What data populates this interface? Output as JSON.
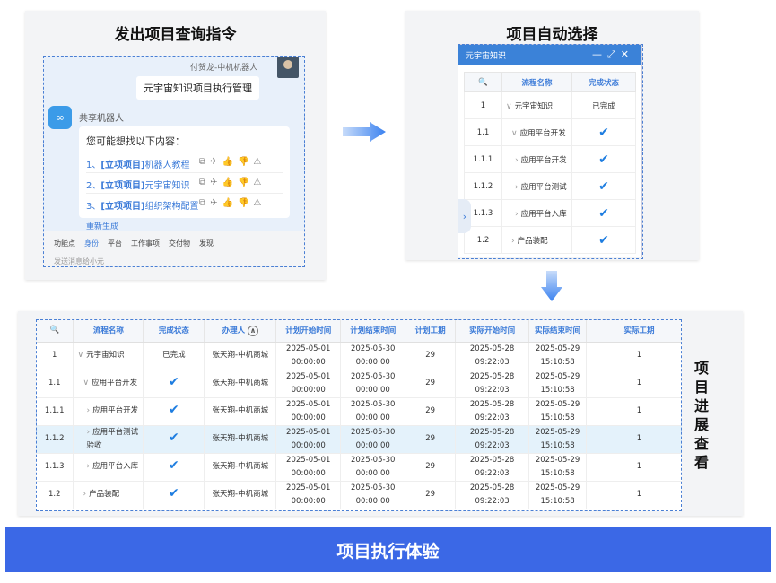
{
  "panel1": {
    "title": "发出项目查询指令",
    "sender": "付贺龙-中机机器人",
    "user_message": "元宇宙知识项目执行管理",
    "bot_name": "共享机器人",
    "bot_intro": "您可能想找以下内容：",
    "suggestions": [
      {
        "num": "1、",
        "tag": "[立项项目]",
        "text": "机器人教程"
      },
      {
        "num": "2、",
        "tag": "[立项项目]",
        "text": "元宇宙知识"
      },
      {
        "num": "3、",
        "tag": "[立项项目]",
        "text": "组织架构配置"
      }
    ],
    "regen": "重新生成",
    "toolbar": [
      "功能点",
      "身份",
      "平台",
      "工作事项",
      "交付物",
      "发现"
    ],
    "input_placeholder": "发送消息给小元"
  },
  "panel2": {
    "title": "项目自动选择",
    "widget_title": "元宇宙知识",
    "headers": [
      "流程名称",
      "完成状态"
    ],
    "rows": [
      {
        "id": "1",
        "name": "元宇宙知识",
        "status": "已完成"
      },
      {
        "id": "1.1",
        "name": "应用平台开发",
        "status": "check"
      },
      {
        "id": "1.1.1",
        "name": "应用平台开发",
        "status": "check"
      },
      {
        "id": "1.1.2",
        "name": "应用平台测试",
        "status": "check"
      },
      {
        "id": "1.1.3",
        "name": "应用平台入库",
        "status": "check"
      },
      {
        "id": "1.2",
        "name": "产品装配",
        "status": "check"
      }
    ]
  },
  "panel3": {
    "side_label": "项目进展查看",
    "headers": [
      "流程名称",
      "完成状态",
      "办理人",
      "计划开始时间",
      "计划结束时间",
      "计划工期",
      "实际开始时间",
      "实际结束时间",
      "实际工期"
    ],
    "rows": [
      {
        "id": "1",
        "name": "元宇宙知识",
        "status": "已完成",
        "owner": "张天翔-中机商城",
        "ps_date": "2025-05-01",
        "ps_time": "00:00:00",
        "pe_date": "2025-05-30",
        "pe_time": "00:00:00",
        "plan_days": "29",
        "as_date": "2025-05-28",
        "as_time": "09:22:03",
        "ae_date": "2025-05-29",
        "ae_time": "15:10:58",
        "actual_days": "1"
      },
      {
        "id": "1.1",
        "name": "应用平台开发",
        "status": "check",
        "owner": "张天翔-中机商城",
        "ps_date": "2025-05-01",
        "ps_time": "00:00:00",
        "pe_date": "2025-05-30",
        "pe_time": "00:00:00",
        "plan_days": "29",
        "as_date": "2025-05-28",
        "as_time": "09:22:03",
        "ae_date": "2025-05-29",
        "ae_time": "15:10:58",
        "actual_days": "1"
      },
      {
        "id": "1.1.1",
        "name": "应用平台开发",
        "status": "check",
        "owner": "张天翔-中机商城",
        "ps_date": "2025-05-01",
        "ps_time": "00:00:00",
        "pe_date": "2025-05-30",
        "pe_time": "00:00:00",
        "plan_days": "29",
        "as_date": "2025-05-28",
        "as_time": "09:22:03",
        "ae_date": "2025-05-29",
        "ae_time": "15:10:58",
        "actual_days": "1"
      },
      {
        "id": "1.1.2",
        "name": "应用平台测试验收",
        "status": "check",
        "owner": "张天翔-中机商城",
        "ps_date": "2025-05-01",
        "ps_time": "00:00:00",
        "pe_date": "2025-05-30",
        "pe_time": "00:00:00",
        "plan_days": "29",
        "as_date": "2025-05-28",
        "as_time": "09:22:03",
        "ae_date": "2025-05-29",
        "ae_time": "15:10:58",
        "actual_days": "1"
      },
      {
        "id": "1.1.3",
        "name": "应用平台入库",
        "status": "check",
        "owner": "张天翔-中机商城",
        "ps_date": "2025-05-01",
        "ps_time": "00:00:00",
        "pe_date": "2025-05-30",
        "pe_time": "00:00:00",
        "plan_days": "29",
        "as_date": "2025-05-28",
        "as_time": "09:22:03",
        "ae_date": "2025-05-29",
        "ae_time": "15:10:58",
        "actual_days": "1"
      },
      {
        "id": "1.2",
        "name": "产品装配",
        "status": "check",
        "owner": "张天翔-中机商城",
        "ps_date": "2025-05-01",
        "ps_time": "00:00:00",
        "pe_date": "2025-05-30",
        "pe_time": "00:00:00",
        "plan_days": "29",
        "as_date": "2025-05-28",
        "as_time": "09:22:03",
        "ae_date": "2025-05-29",
        "ae_time": "15:10:58",
        "actual_days": "1"
      }
    ]
  },
  "banner": "项目执行体验",
  "colors": {
    "accent": "#3b82d8",
    "banner": "#3b68e6",
    "highlight_row": "#e4f2fb"
  },
  "icons": [
    "search-icon",
    "chevron-right-icon",
    "chevron-down-icon",
    "check-icon",
    "minimize-icon",
    "maximize-icon",
    "close-icon",
    "copy-icon",
    "share-icon",
    "thumb-up-icon",
    "thumb-down-icon",
    "warning-icon"
  ]
}
